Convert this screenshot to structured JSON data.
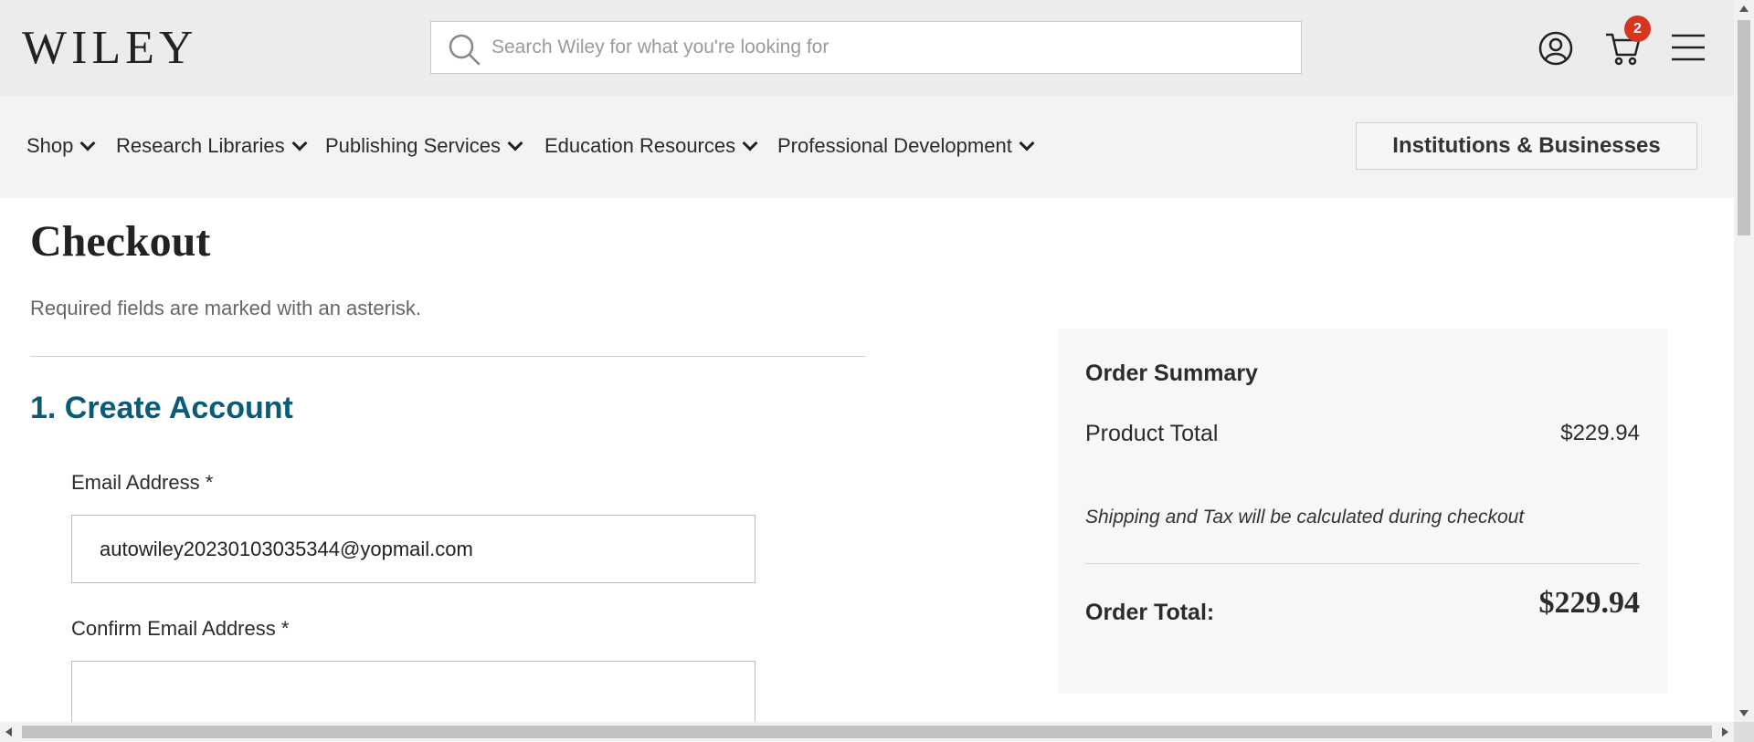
{
  "header": {
    "logo_text": "WILEY",
    "search": {
      "placeholder": "Search Wiley for what you're looking for"
    },
    "icons": {
      "search": "search-icon",
      "account": "user-account-icon",
      "cart": "shopping-cart-icon",
      "menu": "hamburger-menu-icon"
    },
    "cart_count": "2"
  },
  "nav": {
    "items": [
      {
        "label": "Shop"
      },
      {
        "label": "Research Libraries"
      },
      {
        "label": "Publishing Services"
      },
      {
        "label": "Education Resources"
      },
      {
        "label": "Professional Development"
      }
    ],
    "institutions_button": "Institutions & Businesses"
  },
  "main": {
    "title": "Checkout",
    "required_note": "Required fields are marked with an asterisk.",
    "section_title": "1. Create Account",
    "email": {
      "label": "Email Address *",
      "value": "autowiley20230103035344@yopmail.com"
    },
    "confirm_email": {
      "label": "Confirm Email Address *",
      "value": ""
    }
  },
  "summary": {
    "title": "Order Summary",
    "product_total_label": "Product Total",
    "product_total_value": "$229.94",
    "shipping_note": "Shipping and Tax will be calculated during checkout",
    "order_total_label": "Order Total:",
    "order_total_value": "$229.94"
  },
  "colors": {
    "accent": "#0a5a7a",
    "badge": "#d6361e",
    "header_bg": "#ececec",
    "nav_bg": "#f3f3f3"
  }
}
